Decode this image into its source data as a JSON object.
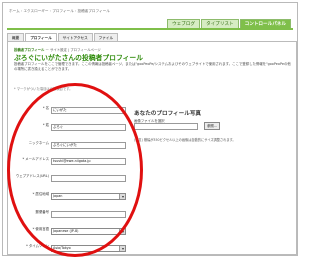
{
  "breadcrumb": [
    "ホーム",
    "エクスローギー",
    "プロフィール",
    "投稿者プロフィール"
  ],
  "breadcrumb_sep": "›",
  "top_nav": [
    {
      "label": "ウェブログ",
      "active": false
    },
    {
      "label": "タイプリスト",
      "active": false
    },
    {
      "label": "コントロールパネル",
      "active": true
    }
  ],
  "sub_tabs": [
    {
      "label": "概要",
      "active": false
    },
    {
      "label": "プロフィール",
      "active": true
    },
    {
      "label": "サイトアクセス",
      "active": false
    },
    {
      "label": "ファイル",
      "active": false
    }
  ],
  "section_label_bold": "投稿者プロフィール",
  "section_label_rest": "ー サイト設定 | プロフィールページ",
  "page_title": "ぷろぐにいがたさんの投稿者プロフィール",
  "description": "投稿者プロフィールをここで管理できます。ここの情報は投稿者ページ、または\"gooPeoPe/システムおよびそのウェブサイトで使用されます。ここで登録した情報を\"gooPeoPeの他の場所に書き換えることができます。",
  "required_note": "* マークがついた項目は必須項目です。",
  "form": [
    {
      "label": "* 名",
      "value": "にいがた",
      "type": "input"
    },
    {
      "label": "* 姓",
      "value": "ぷろぐ",
      "type": "input"
    },
    {
      "label": "ニックネーム",
      "value": "ぷろぐにいがた",
      "type": "input"
    },
    {
      "label": "* メールアドレス",
      "value": "tsushi@ewe-niigata.jp",
      "type": "input"
    },
    {
      "label": "ウェブアドレス(URL)",
      "value": "",
      "type": "input"
    },
    {
      "label": "* 居住地域",
      "value": "Japan",
      "type": "select"
    },
    {
      "label": "郵便番号",
      "value": "",
      "type": "input"
    },
    {
      "label": "* 使用言語",
      "value": "Japanese (JP-8)",
      "type": "select"
    },
    {
      "label": "* タイムゾーン",
      "value": "Asia/Tokyo",
      "type": "select"
    }
  ],
  "photo": {
    "title": "あなたのプロフィール写真",
    "sub_label": "画像ファイルを選択",
    "button_label": "参照...",
    "note": "(任意) 横幅が350ピクセル以上の画像は自動的にサイズ調整されます。"
  },
  "colors": {
    "accent": "#7fbf4a",
    "title": "#2e8b0a",
    "highlight": "#e01010"
  }
}
